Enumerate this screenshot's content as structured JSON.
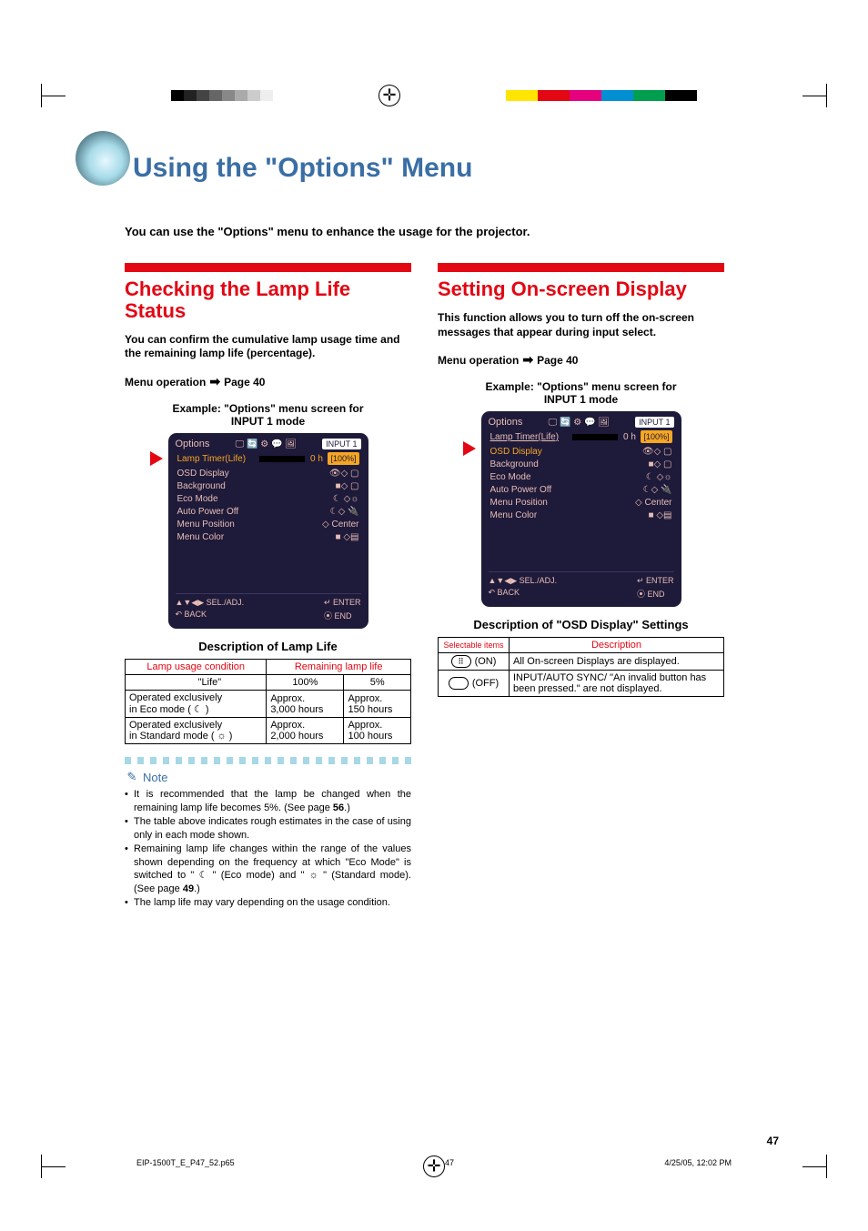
{
  "title": "Using the \"Options\" Menu",
  "intro": "You can use the \"Options\" menu to enhance the usage for the projector.",
  "page_number": "47",
  "left": {
    "heading_line1": "Checking the Lamp Life",
    "heading_line2": "Status",
    "desc": "You can confirm the cumulative lamp usage time and the remaining lamp life (percentage).",
    "menu_op_label": "Menu operation",
    "menu_op_page": "Page 40",
    "example_label_l1": "Example: \"Options\" menu screen for",
    "example_label_l2": "INPUT 1 mode",
    "osd": {
      "title": "Options",
      "input_badge": "INPUT 1",
      "lamp_row": {
        "label": "Lamp Timer(Life)",
        "val": "0 h",
        "pct": "[100%]"
      },
      "items": [
        {
          "label": "OSD Display",
          "val": ""
        },
        {
          "label": "Background",
          "val": ""
        },
        {
          "label": "Eco Mode",
          "val": ""
        },
        {
          "label": "Auto Power Off",
          "val": ""
        },
        {
          "label": "Menu Position",
          "val": "◇ Center"
        },
        {
          "label": "Menu Color",
          "val": ""
        }
      ],
      "footer": {
        "sel": "▲▼◀▶ SEL./ADJ.",
        "back": "↶ BACK",
        "enter": "↵ ENTER",
        "end": "⦿ END"
      }
    },
    "lamp_desc_title": "Description of Lamp Life",
    "lamp_table": {
      "headers": [
        "Lamp usage condition",
        "Remaining lamp life"
      ],
      "sub_headers": [
        "",
        "\"Life\"",
        "100%",
        "5%"
      ],
      "rows": [
        {
          "cond_l1": "Operated exclusively",
          "cond_l2": "in Eco mode (    )",
          "c100": "Approx.\n3,000 hours",
          "c5": "Approx.\n150 hours"
        },
        {
          "cond_l1": "Operated exclusively",
          "cond_l2": "in Standard mode (    )",
          "c100": "Approx.\n2,000 hours",
          "c5": "Approx.\n100 hours"
        }
      ]
    },
    "note_label": "Note",
    "notes": [
      "It is recommended that the lamp be changed when the remaining lamp life becomes 5%. (See page 56.)",
      "The table above indicates rough estimates in the case of using only in each mode shown.",
      "Remaining lamp life changes within the range of the values shown depending on the frequency at which \"Eco Mode\" is switched to \"    \" (Eco mode) and \"    \" (Standard mode). (See page 49.)",
      "The lamp life may vary depending on the usage condition."
    ]
  },
  "right": {
    "heading": "Setting On-screen Display",
    "desc": "This function allows you to turn off the on-screen messages that appear during input select.",
    "menu_op_label": "Menu operation",
    "menu_op_page": "Page 40",
    "example_label_l1": "Example: \"Options\" menu screen for",
    "example_label_l2": "INPUT 1 mode",
    "osd": {
      "title": "Options",
      "input_badge": "INPUT 1",
      "lamp_row": {
        "label": "Lamp Timer(Life)",
        "val": "0 h",
        "pct": "[100%]"
      },
      "items": [
        {
          "label": "OSD Display",
          "val": ""
        },
        {
          "label": "Background",
          "val": ""
        },
        {
          "label": "Eco Mode",
          "val": ""
        },
        {
          "label": "Auto Power Off",
          "val": ""
        },
        {
          "label": "Menu Position",
          "val": "◇ Center"
        },
        {
          "label": "Menu Color",
          "val": ""
        }
      ],
      "footer": {
        "sel": "▲▼◀▶ SEL./ADJ.",
        "back": "↶ BACK",
        "enter": "↵ ENTER",
        "end": "⦿ END"
      }
    },
    "osd_desc_title": "Description of \"OSD Display\" Settings",
    "osd_table": {
      "header_left": "Selectable items",
      "header_right": "Description",
      "rows": [
        {
          "icon": "▭",
          "state": "(ON)",
          "desc": "All On-screen Displays are displayed."
        },
        {
          "icon": "▭",
          "state": "(OFF)",
          "desc": "INPUT/AUTO SYNC/ \"An invalid button has been pressed.\" are not displayed."
        }
      ]
    }
  },
  "footer": {
    "file_info": "EIP-1500T_E_P47_52.p65",
    "page": "47",
    "timestamp": "4/25/05, 12:02 PM"
  }
}
